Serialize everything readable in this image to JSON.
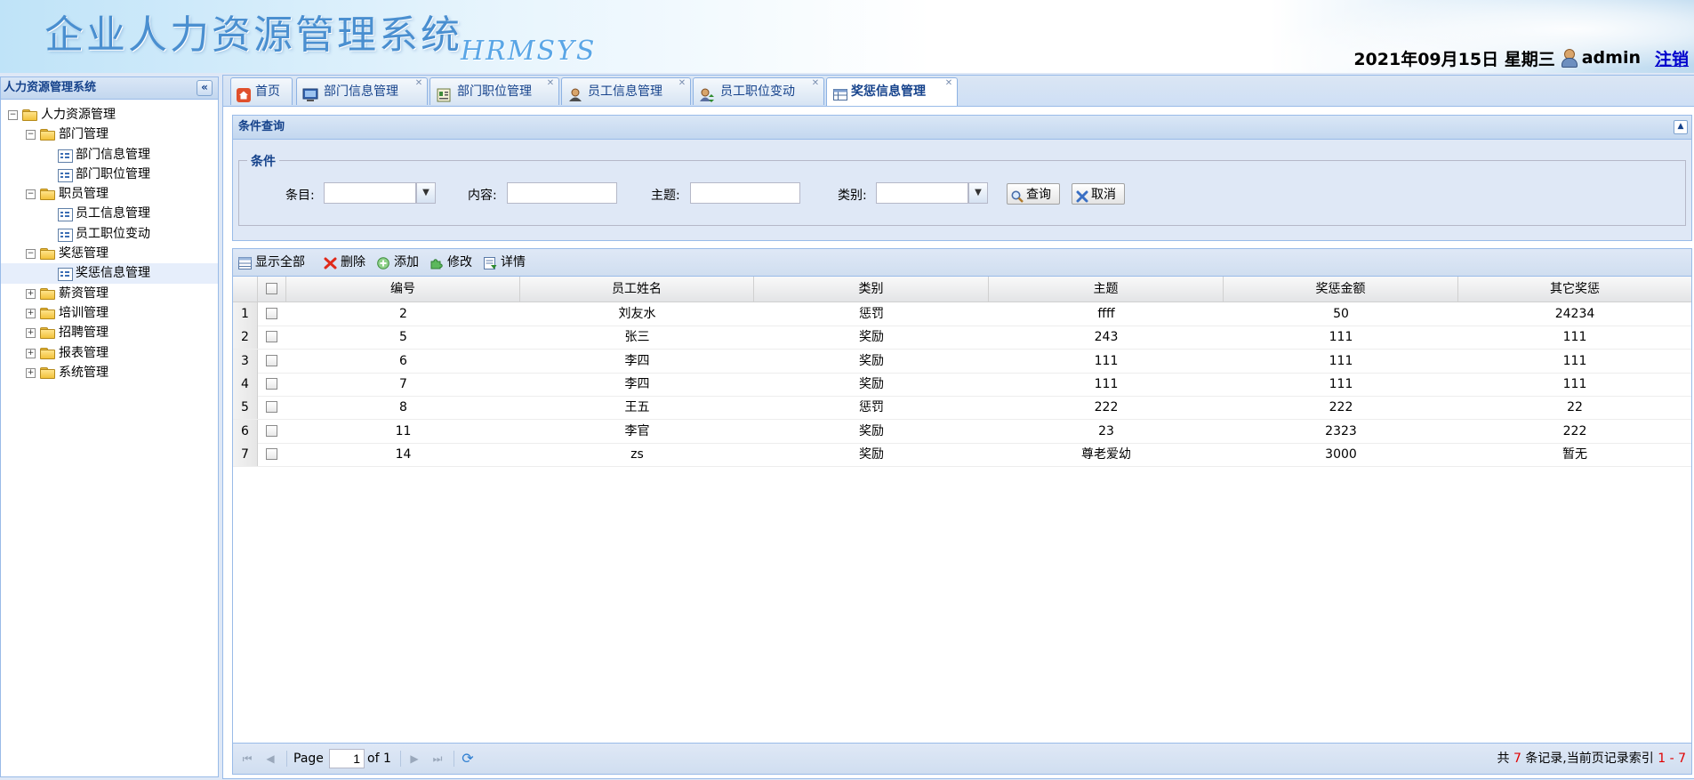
{
  "header": {
    "title": "企业人力资源管理系统",
    "subtitle": "HRMSYS",
    "date": "2021年09月15日 星期三",
    "user": "admin",
    "logout": "注销"
  },
  "west": {
    "title": "人力资源管理系统",
    "tree": {
      "root": "人力资源管理",
      "dept": "部门管理",
      "dept_info": "部门信息管理",
      "dept_post": "部门职位管理",
      "staff": "职员管理",
      "emp_info": "员工信息管理",
      "emp_change": "员工职位变动",
      "reward": "奖惩管理",
      "reward_info": "奖惩信息管理",
      "salary": "薪资管理",
      "training": "培训管理",
      "recruit": "招聘管理",
      "report": "报表管理",
      "system": "系统管理"
    }
  },
  "tabs": {
    "home": "首页",
    "dept_info": "部门信息管理",
    "dept_post": "部门职位管理",
    "emp_info": "员工信息管理",
    "emp_change": "员工职位变动",
    "reward_info": "奖惩信息管理"
  },
  "query": {
    "panel_title": "条件查询",
    "legend": "条件",
    "item_label": "条目:",
    "content_label": "内容:",
    "subject_label": "主题:",
    "type_label": "类别:",
    "item_value": "",
    "content_value": "",
    "subject_value": "",
    "type_value": "",
    "search_btn": "查询",
    "cancel_btn": "取消"
  },
  "toolbar": {
    "show_all": "显示全部",
    "delete": "删除",
    "add": "添加",
    "edit": "修改",
    "detail": "详情"
  },
  "grid": {
    "columns": [
      "编号",
      "员工姓名",
      "类别",
      "主题",
      "奖惩金额",
      "其它奖惩"
    ],
    "rows": [
      {
        "n": "1",
        "c": [
          "2",
          "刘友水",
          "惩罚",
          "ffff",
          "50",
          "24234"
        ]
      },
      {
        "n": "2",
        "c": [
          "5",
          "张三",
          "奖励",
          "243",
          "111",
          "111"
        ]
      },
      {
        "n": "3",
        "c": [
          "6",
          "李四",
          "奖励",
          "111",
          "111",
          "111"
        ]
      },
      {
        "n": "4",
        "c": [
          "7",
          "李四",
          "奖励",
          "111",
          "111",
          "111"
        ]
      },
      {
        "n": "5",
        "c": [
          "8",
          "王五",
          "惩罚",
          "222",
          "222",
          "22"
        ]
      },
      {
        "n": "6",
        "c": [
          "11",
          "李官",
          "奖励",
          "23",
          "2323",
          "222"
        ]
      },
      {
        "n": "7",
        "c": [
          "14",
          "zs",
          "奖励",
          "尊老爱幼",
          "3000",
          "暂无"
        ]
      }
    ]
  },
  "pager": {
    "page_label": "Page",
    "page_value": "1",
    "of_label": "of 1",
    "info_prefix": "共",
    "total": "7",
    "info_mid": "条记录,当前页记录索引",
    "range": "1 - 7"
  }
}
